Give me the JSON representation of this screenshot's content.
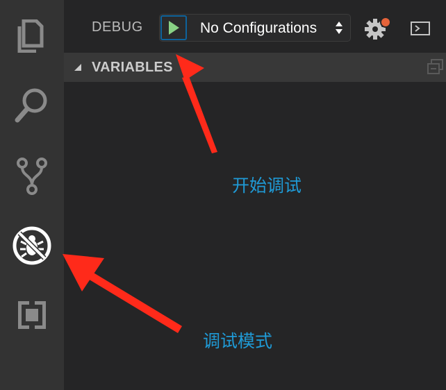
{
  "activity_bar": {
    "items": [
      {
        "name": "explorer",
        "icon": "files-icon",
        "active": false
      },
      {
        "name": "search",
        "icon": "search-icon",
        "active": false
      },
      {
        "name": "source-control",
        "icon": "git-branch-icon",
        "active": false
      },
      {
        "name": "debug",
        "icon": "no-bug-icon",
        "active": true
      },
      {
        "name": "extensions",
        "icon": "extensions-icon",
        "active": false
      }
    ]
  },
  "debug_toolbar": {
    "title": "DEBUG",
    "start_button_icon": "play-icon",
    "configuration_value": "No Configurations",
    "settings_icon": "gear-icon",
    "console_icon": "terminal-icon"
  },
  "variables_section": {
    "title": "VARIABLES",
    "expanded": true
  },
  "annotations": {
    "start_debugging": "开始调试",
    "debug_mode": "调试模式"
  },
  "colors": {
    "activity_bar_bg": "#333333",
    "sidebar_bg": "#252526",
    "section_header_bg": "#383838",
    "play_green": "#89d185",
    "badge_orange": "#e5633a",
    "annotation_blue": "#1f9ad6",
    "arrow_red": "#ff2a1a"
  }
}
